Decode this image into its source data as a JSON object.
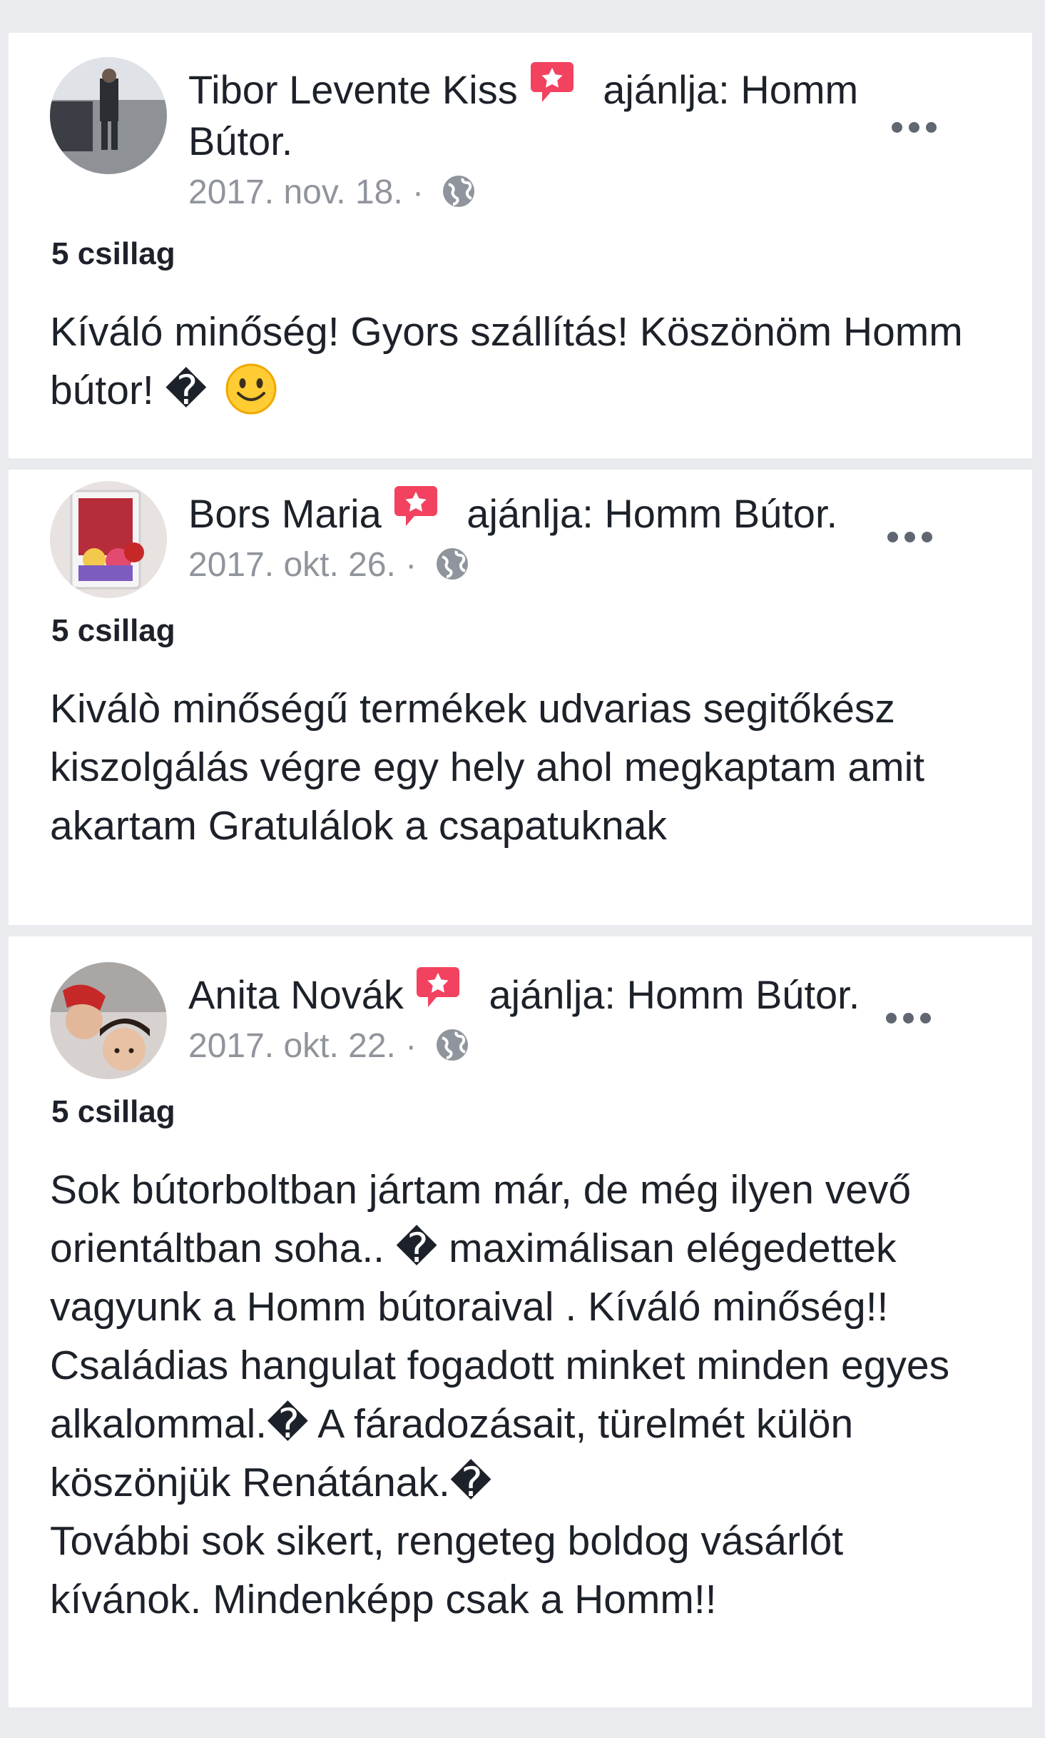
{
  "reviews": [
    {
      "author": "Tibor Levente Kiss",
      "recommends_suffix": " ajánlja: Homm Bútor.",
      "date": "2017. nov. 18.",
      "date_sep": " · ",
      "rating": "5 csillag",
      "text": "Kíváló minőség! Gyors szállítás! Köszönöm Homm bútor! � ",
      "emoji": "smiley"
    },
    {
      "author": "Bors Maria",
      "recommends_suffix": " ajánlja: Homm Bútor.",
      "date": "2017. okt. 26.",
      "date_sep": " · ",
      "rating": "5 csillag",
      "text": "Kiválò minőségű termékek  udvarias segitőkész kiszolgálás végre egy hely ahol megkaptam amit akartam Gratulálok a csapatuknak"
    },
    {
      "author": "Anita Novák",
      "recommends_suffix": " ajánlja: Homm Bútor.",
      "date": "2017. okt. 22.",
      "date_sep": " · ",
      "rating": "5 csillag",
      "text": "Sok bútorboltban jártam már, de még ilyen vevő orientáltban soha.. � maximálisan elégedettek  vagyunk a Homm bútoraival . Kíváló minőség!!  Családias hangulat fogadott minket minden egyes alkalommal.� A fáradozásait, türelmét külön köszönjük Renátának.�\nTovábbi sok sikert, rengeteg boldog vásárlót kívánok. Mindenképp csak a Homm!!"
    }
  ],
  "colors": {
    "background": "#e9ebee",
    "card": "#ffffff",
    "text": "#1d2129",
    "meta": "#90949c",
    "recommend_badge": "#f3425f"
  },
  "icons": [
    "recommendation-star-icon",
    "globe-icon",
    "more-options-icon",
    "smiley-emoji-icon"
  ]
}
